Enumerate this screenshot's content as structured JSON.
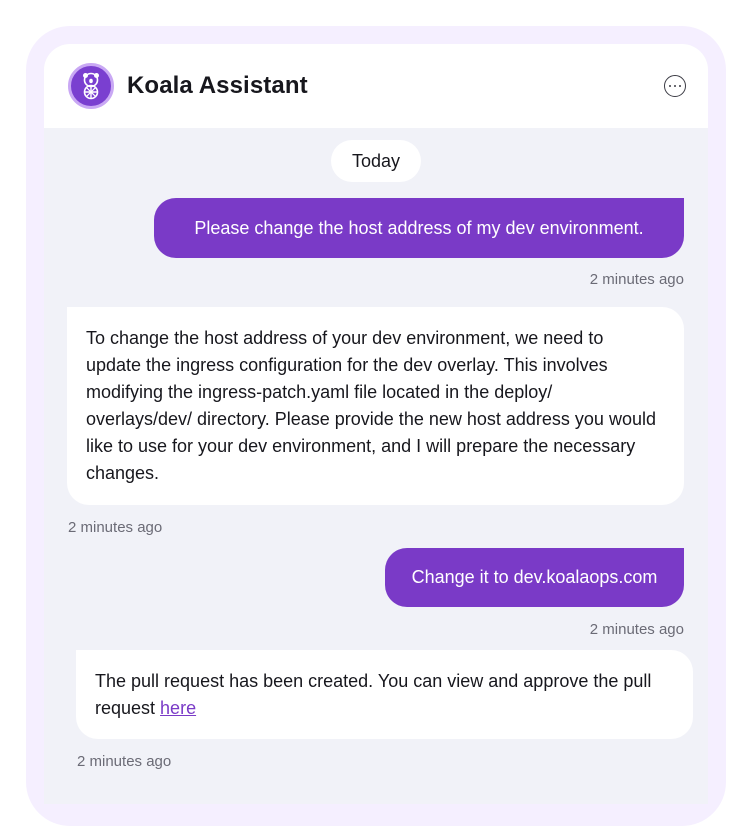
{
  "header": {
    "title": "Koala Assistant",
    "avatar_icon": "koala-logo-icon",
    "menu_icon": "more-horizontal-icon"
  },
  "date_separator": "Today",
  "messages": [
    {
      "sender": "user",
      "text": "Please change the host address of my dev environment.",
      "time": "2 minutes ago"
    },
    {
      "sender": "assistant",
      "text": "To change the host address of your dev environment, we need to update the ingress configuration for the dev overlay. This involves modifying the ingress-patch.yaml file located in the deploy/ overlays/dev/ directory. Please provide the new host address you would like to use for your dev environment, and I will prepare the necessary changes.",
      "time": "2 minutes ago"
    },
    {
      "sender": "user",
      "text": "Change it to dev.koalaops.com",
      "time": "2 minutes ago"
    },
    {
      "sender": "assistant",
      "text": "The pull request has been created. You can view and approve the pull request ",
      "link_text": "here",
      "time": "2 minutes ago"
    }
  ],
  "colors": {
    "accent": "#7a3ac7",
    "background": "#f1f2f8",
    "frame": "#f5efff"
  }
}
